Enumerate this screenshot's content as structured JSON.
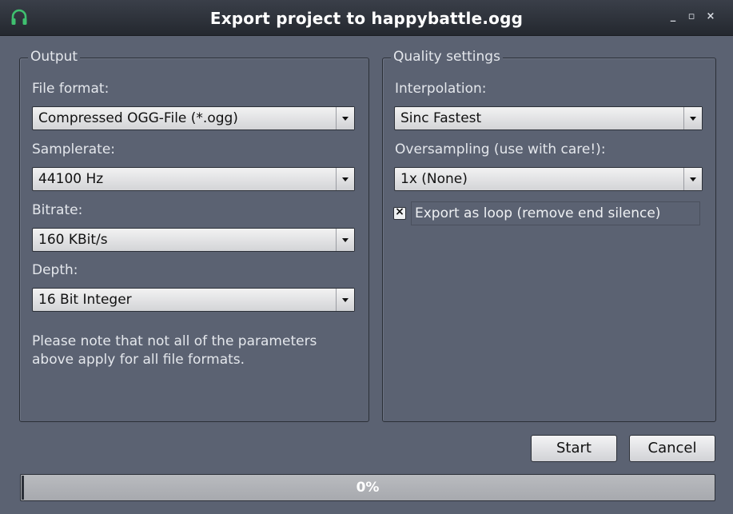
{
  "window": {
    "title": "Export project to happybattle.ogg",
    "app_icon": "headphones-icon",
    "controls": {
      "minimize": "_",
      "maximize": "▫",
      "close": "×"
    }
  },
  "output": {
    "group_title": "Output",
    "file_format": {
      "label": "File format:",
      "value": "Compressed OGG-File (*.ogg)"
    },
    "samplerate": {
      "label": "Samplerate:",
      "value": "44100 Hz"
    },
    "bitrate": {
      "label": "Bitrate:",
      "value": "160 KBit/s"
    },
    "depth": {
      "label": "Depth:",
      "value": "16 Bit Integer"
    },
    "note": "Please note that not all of the parameters above apply for all file formats."
  },
  "quality": {
    "group_title": "Quality settings",
    "interpolation": {
      "label": "Interpolation:",
      "value": "Sinc Fastest"
    },
    "oversampling": {
      "label": "Oversampling (use with care!):",
      "value": "1x (None)"
    },
    "export_loop": {
      "label": "Export as loop (remove end silence)",
      "checked": true,
      "mark": "×"
    }
  },
  "buttons": {
    "start": "Start",
    "cancel": "Cancel"
  },
  "progress": {
    "value": 0,
    "text": "0%"
  },
  "colors": {
    "background": "#5b6272",
    "titlebar": "#2a2e36",
    "accent_icon": "#3fbf6f",
    "text": "#e4e7ec"
  }
}
